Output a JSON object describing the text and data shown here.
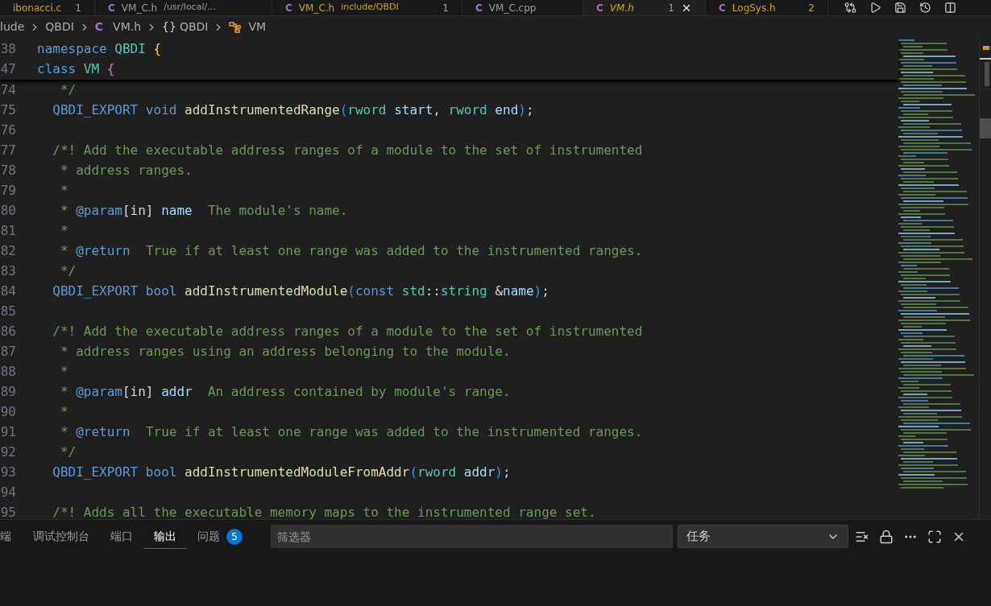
{
  "editor_tabs": [
    {
      "name": "ibonacci.c",
      "badge": "1",
      "color": "#cca700",
      "selected": false
    },
    {
      "icon": "C",
      "name": "VM_C.h",
      "description": "/usr/local/...",
      "color": "#9d9d9d",
      "selected": false
    },
    {
      "icon": "C",
      "name": "VM_C.h",
      "description": "include/QBDI",
      "badge": "1",
      "color": "#cca700",
      "selected": false
    },
    {
      "icon": "C",
      "name": "VM_C.cpp",
      "color": "#9d9d9d",
      "selected": false
    },
    {
      "icon": "C",
      "name": "VM.h",
      "badge": "1",
      "color": "#cca700",
      "selected": true
    },
    {
      "icon": "C",
      "name": "LogSys.h",
      "badge": "2",
      "color": "#cca700",
      "selected": false
    }
  ],
  "breadcrumbs": [
    {
      "kind": "folder",
      "text": "lude"
    },
    {
      "kind": "folder",
      "text": "QBDI"
    },
    {
      "kind": "file",
      "icon": "C",
      "text": "VM.h"
    },
    {
      "kind": "namespace",
      "icon": "{}",
      "text": "QBDI"
    },
    {
      "kind": "class",
      "text": "VM"
    }
  ],
  "sticky_lines": [
    {
      "number": "38",
      "tokens": [
        {
          "kind": "kw",
          "text": "namespace "
        },
        {
          "kind": "type",
          "text": "QBDI "
        },
        {
          "kind": "b1",
          "text": "{"
        }
      ]
    },
    {
      "number": "47",
      "tokens": [
        {
          "kind": "kw",
          "text": "class "
        },
        {
          "kind": "type",
          "text": "VM "
        },
        {
          "kind": "b2",
          "text": "{"
        }
      ]
    }
  ],
  "code_lines": [
    {
      "number": "74",
      "tokens": [
        {
          "kind": "com",
          "text": "   */"
        }
      ]
    },
    {
      "number": "75",
      "tokens": [
        {
          "kind": "kw",
          "text": "  QBDI_EXPORT void "
        },
        {
          "kind": "fn",
          "text": "addInstrumentedRange"
        },
        {
          "kind": "b3",
          "text": "("
        },
        {
          "kind": "type",
          "text": "rword "
        },
        {
          "kind": "var",
          "text": "start"
        },
        {
          "kind": "plain",
          "text": ", "
        },
        {
          "kind": "type",
          "text": "rword "
        },
        {
          "kind": "var",
          "text": "end"
        },
        {
          "kind": "b3",
          "text": ")"
        },
        {
          "kind": "plain",
          "text": ";"
        }
      ]
    },
    {
      "number": "76"
    },
    {
      "number": "77",
      "tokens": [
        {
          "kind": "com",
          "text": "  /*! Add the executable address ranges of a module to the set of instrumented"
        }
      ]
    },
    {
      "number": "78",
      "tokens": [
        {
          "kind": "com",
          "text": "   * address ranges."
        }
      ]
    },
    {
      "number": "79",
      "tokens": [
        {
          "kind": "com",
          "text": "   *"
        }
      ]
    },
    {
      "number": "80",
      "tokens": [
        {
          "kind": "com",
          "text": "   * "
        },
        {
          "kind": "kw",
          "text": "@param"
        },
        {
          "kind": "plain",
          "text": "[in] "
        },
        {
          "kind": "var",
          "text": "name"
        },
        {
          "kind": "com",
          "text": "  The module's name."
        }
      ]
    },
    {
      "number": "81",
      "tokens": [
        {
          "kind": "com",
          "text": "   *"
        }
      ]
    },
    {
      "number": "82",
      "tokens": [
        {
          "kind": "com",
          "text": "   * "
        },
        {
          "kind": "kw",
          "text": "@return"
        },
        {
          "kind": "com",
          "text": "  True if at least one range was added to the instrumented ranges."
        }
      ]
    },
    {
      "number": "83",
      "tokens": [
        {
          "kind": "com",
          "text": "   */"
        }
      ]
    },
    {
      "number": "84",
      "tokens": [
        {
          "kind": "kw",
          "text": "  QBDI_EXPORT bool "
        },
        {
          "kind": "fn",
          "text": "addInstrumentedModule"
        },
        {
          "kind": "b3",
          "text": "("
        },
        {
          "kind": "kw",
          "text": "const "
        },
        {
          "kind": "type",
          "text": "std"
        },
        {
          "kind": "plain",
          "text": "::"
        },
        {
          "kind": "type",
          "text": "string "
        },
        {
          "kind": "plain",
          "text": "&"
        },
        {
          "kind": "var",
          "text": "name"
        },
        {
          "kind": "b3",
          "text": ")"
        },
        {
          "kind": "plain",
          "text": ";"
        }
      ]
    },
    {
      "number": "85"
    },
    {
      "number": "86",
      "tokens": [
        {
          "kind": "com",
          "text": "  /*! Add the executable address ranges of a module to the set of instrumented"
        }
      ]
    },
    {
      "number": "87",
      "tokens": [
        {
          "kind": "com",
          "text": "   * address ranges using an address belonging to the module."
        }
      ]
    },
    {
      "number": "88",
      "tokens": [
        {
          "kind": "com",
          "text": "   *"
        }
      ]
    },
    {
      "number": "89",
      "tokens": [
        {
          "kind": "com",
          "text": "   * "
        },
        {
          "kind": "kw",
          "text": "@param"
        },
        {
          "kind": "plain",
          "text": "[in] "
        },
        {
          "kind": "var",
          "text": "addr"
        },
        {
          "kind": "com",
          "text": "  An address contained by module's range."
        }
      ]
    },
    {
      "number": "90",
      "tokens": [
        {
          "kind": "com",
          "text": "   *"
        }
      ]
    },
    {
      "number": "91",
      "tokens": [
        {
          "kind": "com",
          "text": "   * "
        },
        {
          "kind": "kw",
          "text": "@return"
        },
        {
          "kind": "com",
          "text": "  True if at least one range was added to the instrumented ranges."
        }
      ]
    },
    {
      "number": "92",
      "tokens": [
        {
          "kind": "com",
          "text": "   */"
        }
      ]
    },
    {
      "number": "93",
      "tokens": [
        {
          "kind": "kw",
          "text": "  QBDI_EXPORT bool "
        },
        {
          "kind": "fn",
          "text": "addInstrumentedModuleFromAddr"
        },
        {
          "kind": "b3",
          "text": "("
        },
        {
          "kind": "type",
          "text": "rword "
        },
        {
          "kind": "var",
          "text": "addr"
        },
        {
          "kind": "b3",
          "text": ")"
        },
        {
          "kind": "plain",
          "text": ";"
        }
      ]
    },
    {
      "number": "94"
    },
    {
      "number": "95",
      "tokens": [
        {
          "kind": "com",
          "text": "  /*! Adds all the executable memory maps to the instrumented range set."
        }
      ]
    }
  ],
  "panel": {
    "tabs": [
      {
        "label": "端",
        "selected": false
      },
      {
        "label": "调试控制台",
        "selected": false
      },
      {
        "label": "端口",
        "selected": false
      },
      {
        "label": "输出",
        "selected": true
      },
      {
        "label": "问题",
        "badge": "5",
        "selected": false
      }
    ],
    "filter": {
      "placeholder": "筛选器"
    },
    "channel_select": {
      "value": "任务"
    }
  }
}
